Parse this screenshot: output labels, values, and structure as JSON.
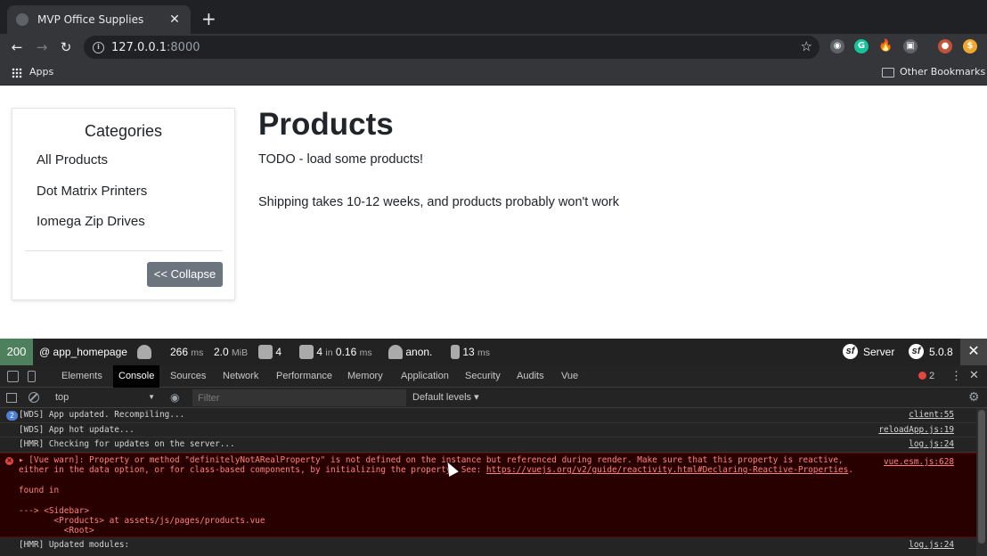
{
  "browser": {
    "tab_title": "MVP Office Supplies",
    "url_host": "127.0.0.1",
    "url_port": ":8000",
    "bookmarks": {
      "apps_label": "Apps",
      "other_label": "Other Bookmarks"
    }
  },
  "sidebar": {
    "title": "Categories",
    "items": [
      {
        "label": "All Products"
      },
      {
        "label": "Dot Matrix Printers"
      },
      {
        "label": "Iomega Zip Drives"
      }
    ],
    "collapse_label": "<< Collapse"
  },
  "main": {
    "title": "Products",
    "todo": "TODO - load some products!",
    "shipping": "Shipping takes 10-12 weeks, and products probably won't work"
  },
  "symfony_toolbar": {
    "status": "200",
    "route": "@ app_homepage",
    "time_value": "266",
    "time_unit": "ms",
    "memory_value": "2.0",
    "memory_unit": "MiB",
    "forms_count": "4",
    "db_queries": "4",
    "db_in": "in",
    "db_time": "0.16",
    "db_unit": "ms",
    "user": "anon.",
    "twig_time": "13",
    "twig_unit": "ms",
    "server_label": "Server",
    "version": "5.0.8",
    "colors": {
      "status_bg": "#4f805d",
      "bar_bg": "#222222"
    }
  },
  "devtools": {
    "tabs": [
      "Elements",
      "Console",
      "Sources",
      "Network",
      "Performance",
      "Memory",
      "Application",
      "Security",
      "Audits",
      "Vue"
    ],
    "active_tab": "Console",
    "error_count": "2",
    "context": "top",
    "filter_placeholder": "Filter",
    "levels": "Default levels ▾"
  },
  "console": {
    "logs": [
      {
        "count": "2",
        "text": "[WDS] App updated. Recompiling...",
        "src": "client:55"
      },
      {
        "text": "[WDS] App hot update...",
        "src": "reloadApp.js:19"
      },
      {
        "text": "[HMR] Checking for updates on the server...",
        "src": "log.js:24"
      }
    ],
    "error": {
      "line1": "▸ [Vue warn]: Property or method \"definitelyNotARealProperty\" is not defined on the instance but referenced during render. Make sure that this property is reactive,",
      "line2_prefix": "either in the data option, or for class-based components, by initializing the property. See: ",
      "line2_link": "https://vuejs.org/v2/guide/reactivity.html#Declaring-Reactive-Properties",
      "line2_suffix": ".",
      "found_in": "found in",
      "trace1": "---> <Sidebar>",
      "trace2": "       <Products> at assets/js/pages/products.vue",
      "trace3": "         <Root>",
      "src": "vue.esm.js:628"
    },
    "last": {
      "text": "[HMR] Updated modules:",
      "src": "log.js:24"
    }
  }
}
